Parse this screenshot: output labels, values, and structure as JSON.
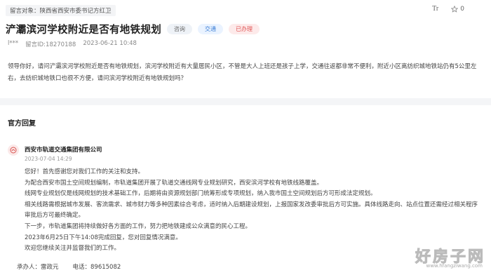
{
  "header": {
    "target_label": "留言对象：陕西省西安市委书记方红卫",
    "font_tool": "Tr",
    "favorite_count": "0"
  },
  "question": {
    "title": "浐灞滨河学校附近是否有地铁规划",
    "tags": [
      "咨询",
      "交通",
      "已办理"
    ],
    "author": "l***",
    "message_id": "留言ID:18270188",
    "time": "2023-06-21 10:48",
    "body_lines": [
      "领导你好，请问浐灞滨河学校附近是否有地铁规划，滨河学校附近有大量居民小区，不管是大人上班还是孩子上学，交通往返都非常不便利，附近小区离纺织城地铁站仍有5公里左",
      "右，去纺织城地铁口也很不方便，请问滨河学校附近有地铁规划吗？"
    ]
  },
  "reply_section": {
    "title": "官方回复",
    "org": "西安市轨道交通集团有限公司",
    "date": "2023-07-04 14:29",
    "lines": [
      "您好！首先感谢您对我们工作的关注和支持。",
      "为配合西安市国土空间规划编制，市轨道集团开展了轨道交通线网专业规划研究，西安滨河学校有地铁线路覆盖。",
      "线网专业规划仅是线网规划的技术基础工作，后期将由资源规划部门统筹形成专项规划，纳入我市国土空间规划后方可形成法定规划。",
      "相关线路需根据城市发展、客流需求、城市财力等多种因素综合考虑，适时纳入后期建设规划，上报国家发改委审批后方可实施。具体线路走向、站点位置还需经过相关程序",
      "审批后方可最终确定。",
      "下一步，市轨道集团将持续做好各方面的工作，努力把地铁建成公众满意的民心工程。",
      "2023年6月25日下午14:08完成回复，您对回复情况满意。",
      "欢迎您继续关注并监督我们的工作。"
    ],
    "contact_person": "承办人：雷政元",
    "contact_phone": "电话：89615082"
  },
  "watermark": {
    "text": "好房子网",
    "url": "www.hfangziwang.com"
  }
}
